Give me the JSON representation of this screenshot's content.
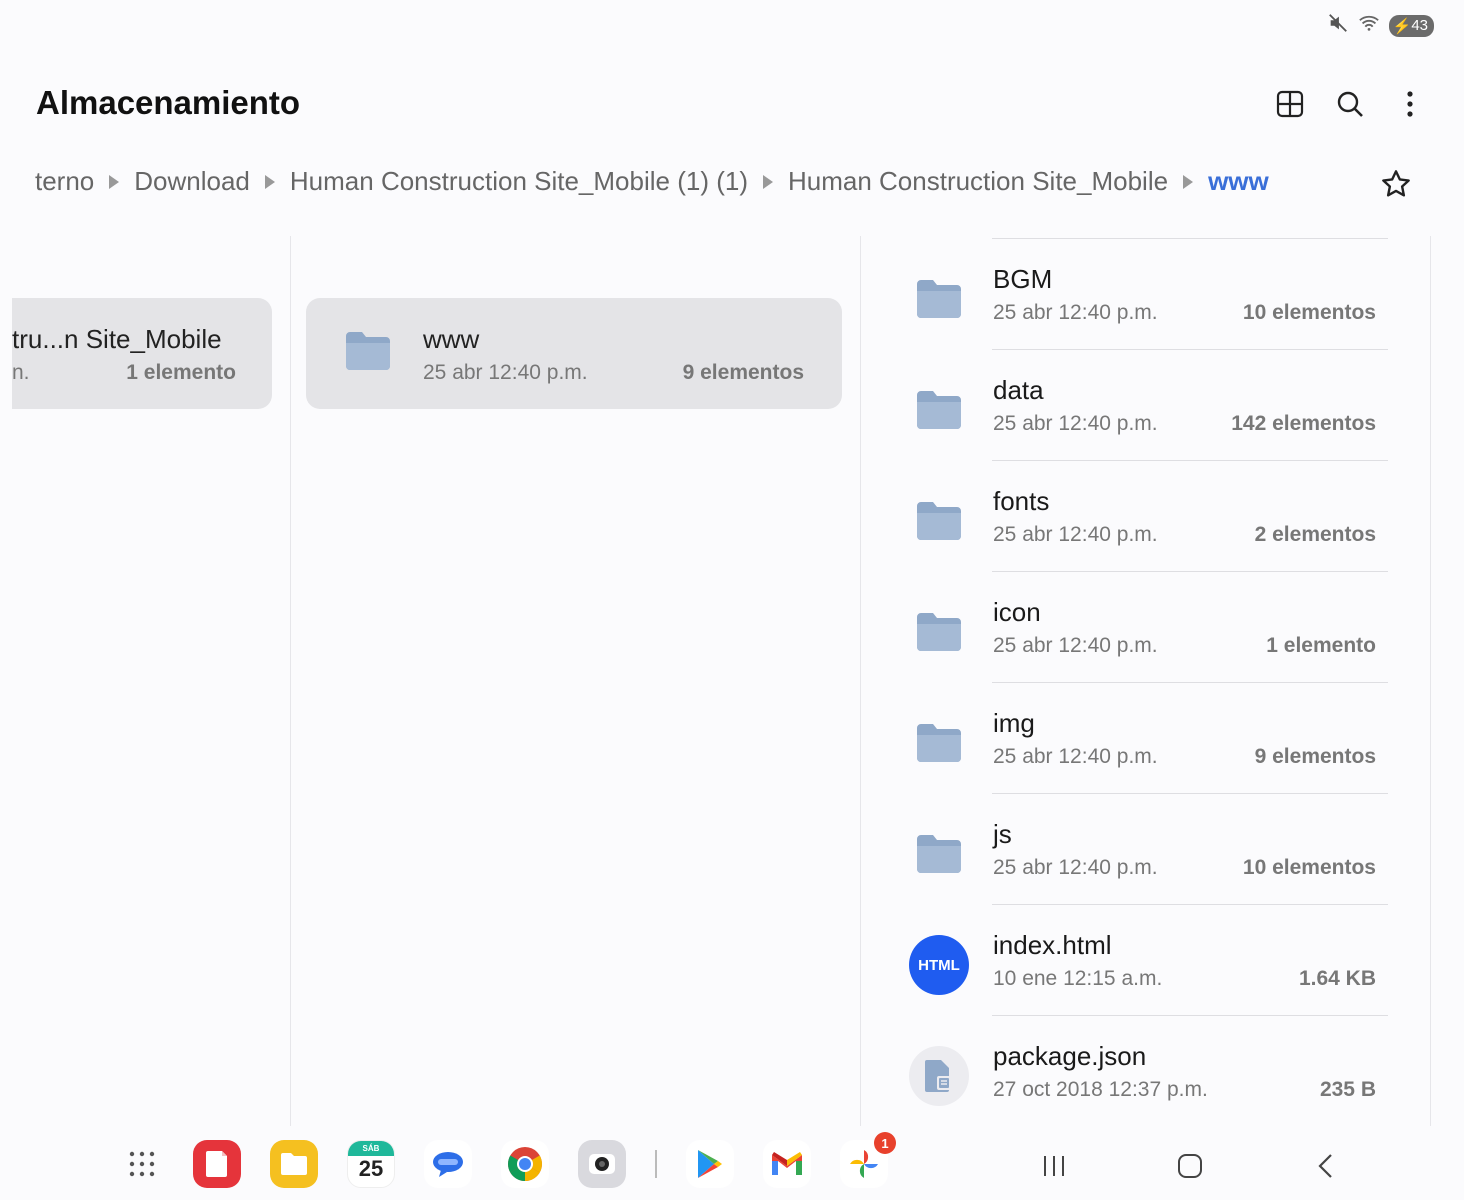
{
  "status": {
    "battery": "43"
  },
  "app": {
    "title": "Almacenamiento"
  },
  "breadcrumb": {
    "items": [
      "terno",
      "Download",
      "Human Construction Site_Mobile (1) (1)",
      "Human Construction Site_Mobile"
    ],
    "current": "www"
  },
  "columns": {
    "left": {
      "name": "tru...n Site_Mobile",
      "meta": "n.",
      "count": "1 elemento"
    },
    "middle": {
      "name": "www",
      "meta": "25 abr 12:40 p.m.",
      "count": "9 elementos"
    }
  },
  "files": [
    {
      "name": "BGM",
      "date": "25 abr 12:40 p.m.",
      "count": "10 elementos",
      "type": "folder"
    },
    {
      "name": "data",
      "date": "25 abr 12:40 p.m.",
      "count": "142 elementos",
      "type": "folder"
    },
    {
      "name": "fonts",
      "date": "25 abr 12:40 p.m.",
      "count": "2 elementos",
      "type": "folder"
    },
    {
      "name": "icon",
      "date": "25 abr 12:40 p.m.",
      "count": "1 elemento",
      "type": "folder"
    },
    {
      "name": "img",
      "date": "25 abr 12:40 p.m.",
      "count": "9 elementos",
      "type": "folder"
    },
    {
      "name": "js",
      "date": "25 abr 12:40 p.m.",
      "count": "10 elementos",
      "type": "folder"
    },
    {
      "name": "index.html",
      "date": "10 ene 12:15 a.m.",
      "count": "1.64 KB",
      "type": "html",
      "badge": "HTML"
    },
    {
      "name": "package.json",
      "date": "27 oct 2018 12:37 p.m.",
      "count": "235 B",
      "type": "json"
    }
  ],
  "dock": {
    "calendar_day": "SÁB",
    "calendar_date": "25",
    "photos_badge": "1"
  },
  "colors": {
    "accent": "#3a6fd8",
    "folder": "#8fa8c8",
    "html": "#1f5cf0"
  }
}
